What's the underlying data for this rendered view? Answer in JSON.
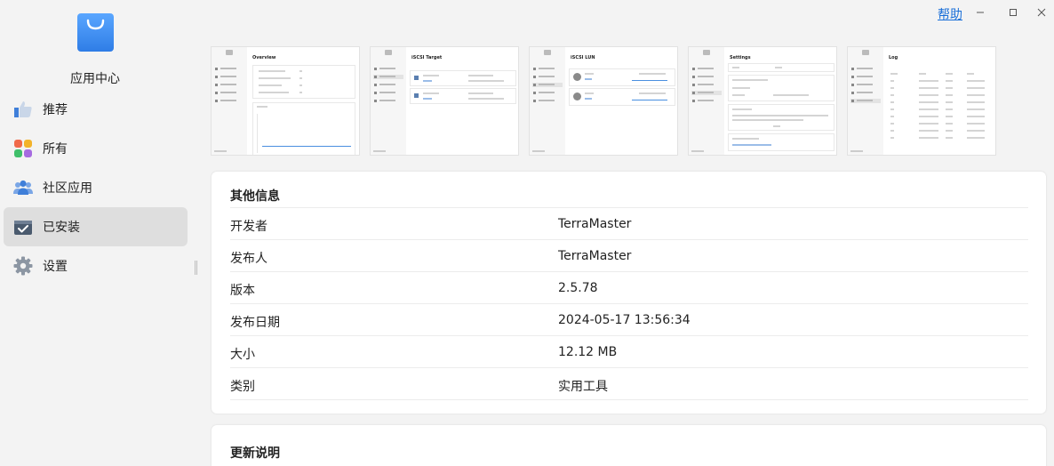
{
  "app": {
    "title": "应用中心"
  },
  "titlebar": {
    "help_label": "帮助"
  },
  "nav": {
    "items": [
      {
        "label": "推荐",
        "icon": "thumbs-up-icon"
      },
      {
        "label": "所有",
        "icon": "apps-grid-icon"
      },
      {
        "label": "社区应用",
        "icon": "community-icon"
      },
      {
        "label": "已安装",
        "icon": "installed-box-icon",
        "active": true
      },
      {
        "label": "设置",
        "icon": "gear-icon"
      }
    ]
  },
  "screenshots": [
    {
      "title": "Overview"
    },
    {
      "title": "iSCSI Target"
    },
    {
      "title": "iSCSI LUN"
    },
    {
      "title": "Settings"
    },
    {
      "title": "Log"
    }
  ],
  "info": {
    "title": "其他信息",
    "rows": [
      {
        "label": "开发者",
        "value": "TerraMaster"
      },
      {
        "label": "发布人",
        "value": "TerraMaster"
      },
      {
        "label": "版本",
        "value": "2.5.78"
      },
      {
        "label": "发布日期",
        "value": "2024-05-17 13:56:34"
      },
      {
        "label": "大小",
        "value": "12.12 MB"
      },
      {
        "label": "类别",
        "value": "实用工具"
      }
    ]
  },
  "notes": {
    "title": "更新说明"
  },
  "colors": {
    "accent": "#1a6fd8",
    "logo": "#3d8ef0",
    "active_bg": "#dedede"
  }
}
